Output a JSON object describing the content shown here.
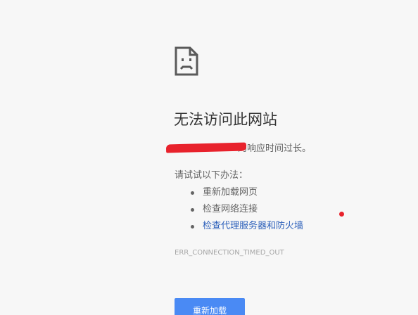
{
  "error": {
    "icon": "sad-page-icon",
    "title": "无法访问此网站",
    "description_suffix": "的响应时间过长。",
    "try_heading": "请试试以下办法：",
    "suggestions": [
      {
        "label": "重新加载网页",
        "is_link": false
      },
      {
        "label": "检查网络连接",
        "is_link": false
      },
      {
        "label": "检查代理服务器和防火墙",
        "is_link": true
      }
    ],
    "code": "ERR_CONNECTION_TIMED_OUT",
    "reload_label": "重新加载"
  },
  "colors": {
    "background": "#f7f7f7",
    "link": "#2b5fba",
    "button": "#4a8af4",
    "redaction": "#e8222c"
  }
}
